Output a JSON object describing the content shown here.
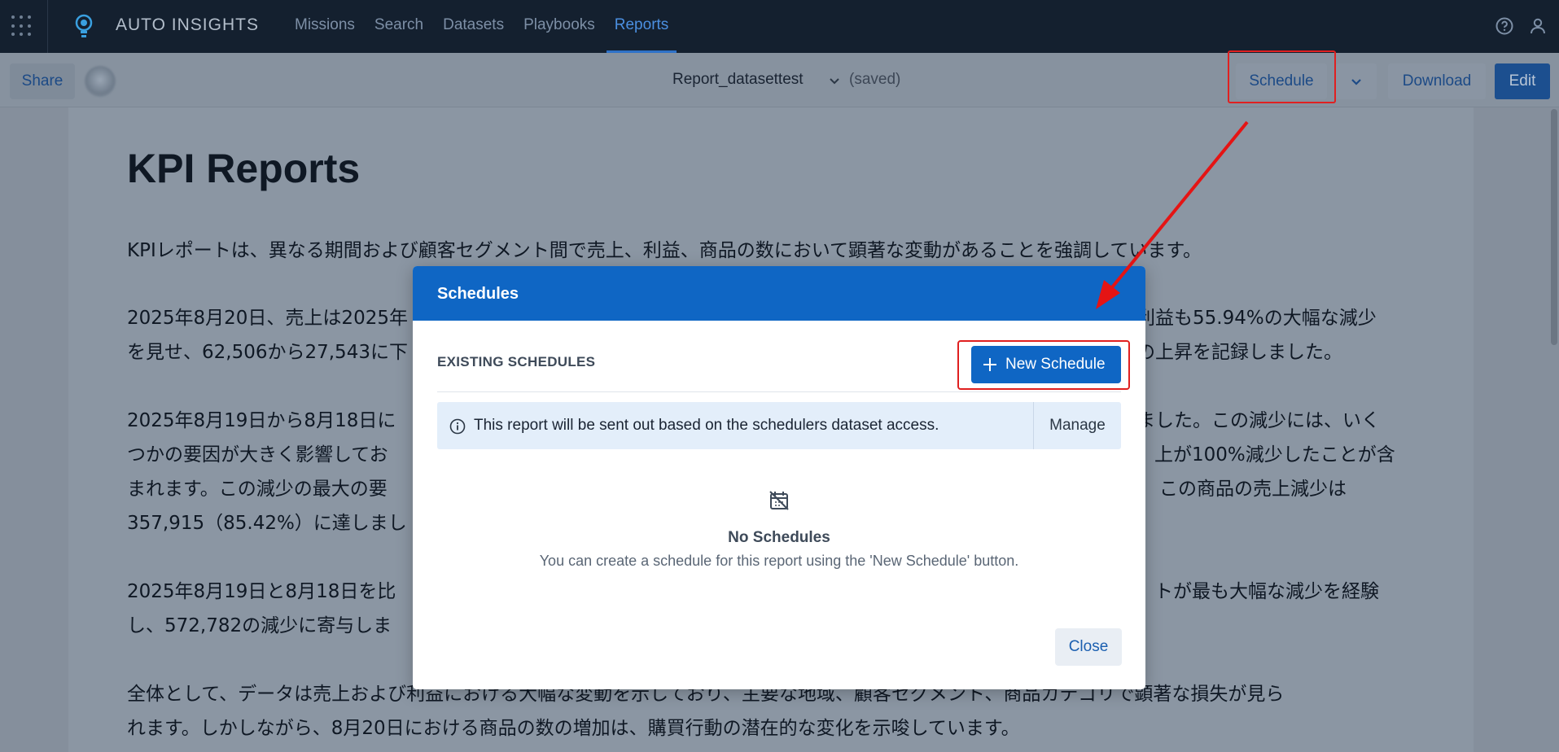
{
  "nav": {
    "brand": "AUTO INSIGHTS",
    "links": [
      {
        "label": "Missions",
        "active": false
      },
      {
        "label": "Search",
        "active": false
      },
      {
        "label": "Datasets",
        "active": false
      },
      {
        "label": "Playbooks",
        "active": false
      },
      {
        "label": "Reports",
        "active": true
      }
    ],
    "icons": [
      "apps-grid-icon",
      "lightbulb-logo-icon",
      "help-icon",
      "user-icon"
    ]
  },
  "toolbar": {
    "share_label": "Share",
    "report_name": "Report_datasettest",
    "saved_status": "(saved)",
    "schedule_label": "Schedule",
    "download_label": "Download",
    "edit_label": "Edit"
  },
  "report": {
    "title": "KPI Reports",
    "paragraphs": [
      "KPIレポートは、異なる期間および顧客セグメント間で売上、利益、商品の数において顕著な変動があることを強調しています。",
      "2025年8月20日、売上は2025年",
      "利益も55.94%の大幅な減少",
      "を見せ、62,506から27,543に下",
      "の上昇を記録しました。",
      "2025年8月19日から8月18日に",
      "ました。この減少には、いく",
      "つかの要因が大きく影響してお",
      "上が100%減少したことが含",
      "まれます。この減少の最大の要",
      "この商品の売上減少は",
      "357,915（85.42%）に達しまし",
      "2025年8月19日と8月18日を比",
      "トが最も大幅な減少を経験",
      "し、572,782の減少に寄与しま",
      "全体として、データは売上および利益における大幅な変動を示しており、主要な地域、顧客セグメント、商品カテゴリで顕著な損失が見ら",
      "れます。しかしながら、8月20日における商品の数の増加は、購買行動の潜在的な変化を示唆しています。"
    ]
  },
  "modal": {
    "title": "Schedules",
    "existing_label": "EXISTING SCHEDULES",
    "new_button": "New Schedule",
    "info_text": "This report will be sent out based on the schedulers dataset access.",
    "manage_label": "Manage",
    "empty_title": "No Schedules",
    "empty_subtitle": "You can create a schedule for this report using the 'New Schedule' button.",
    "close_label": "Close"
  },
  "colors": {
    "nav_bg": "#14202f",
    "accent_blue": "#0f66c4",
    "highlight_red": "#e02020",
    "overlay": "#8b96a3"
  }
}
